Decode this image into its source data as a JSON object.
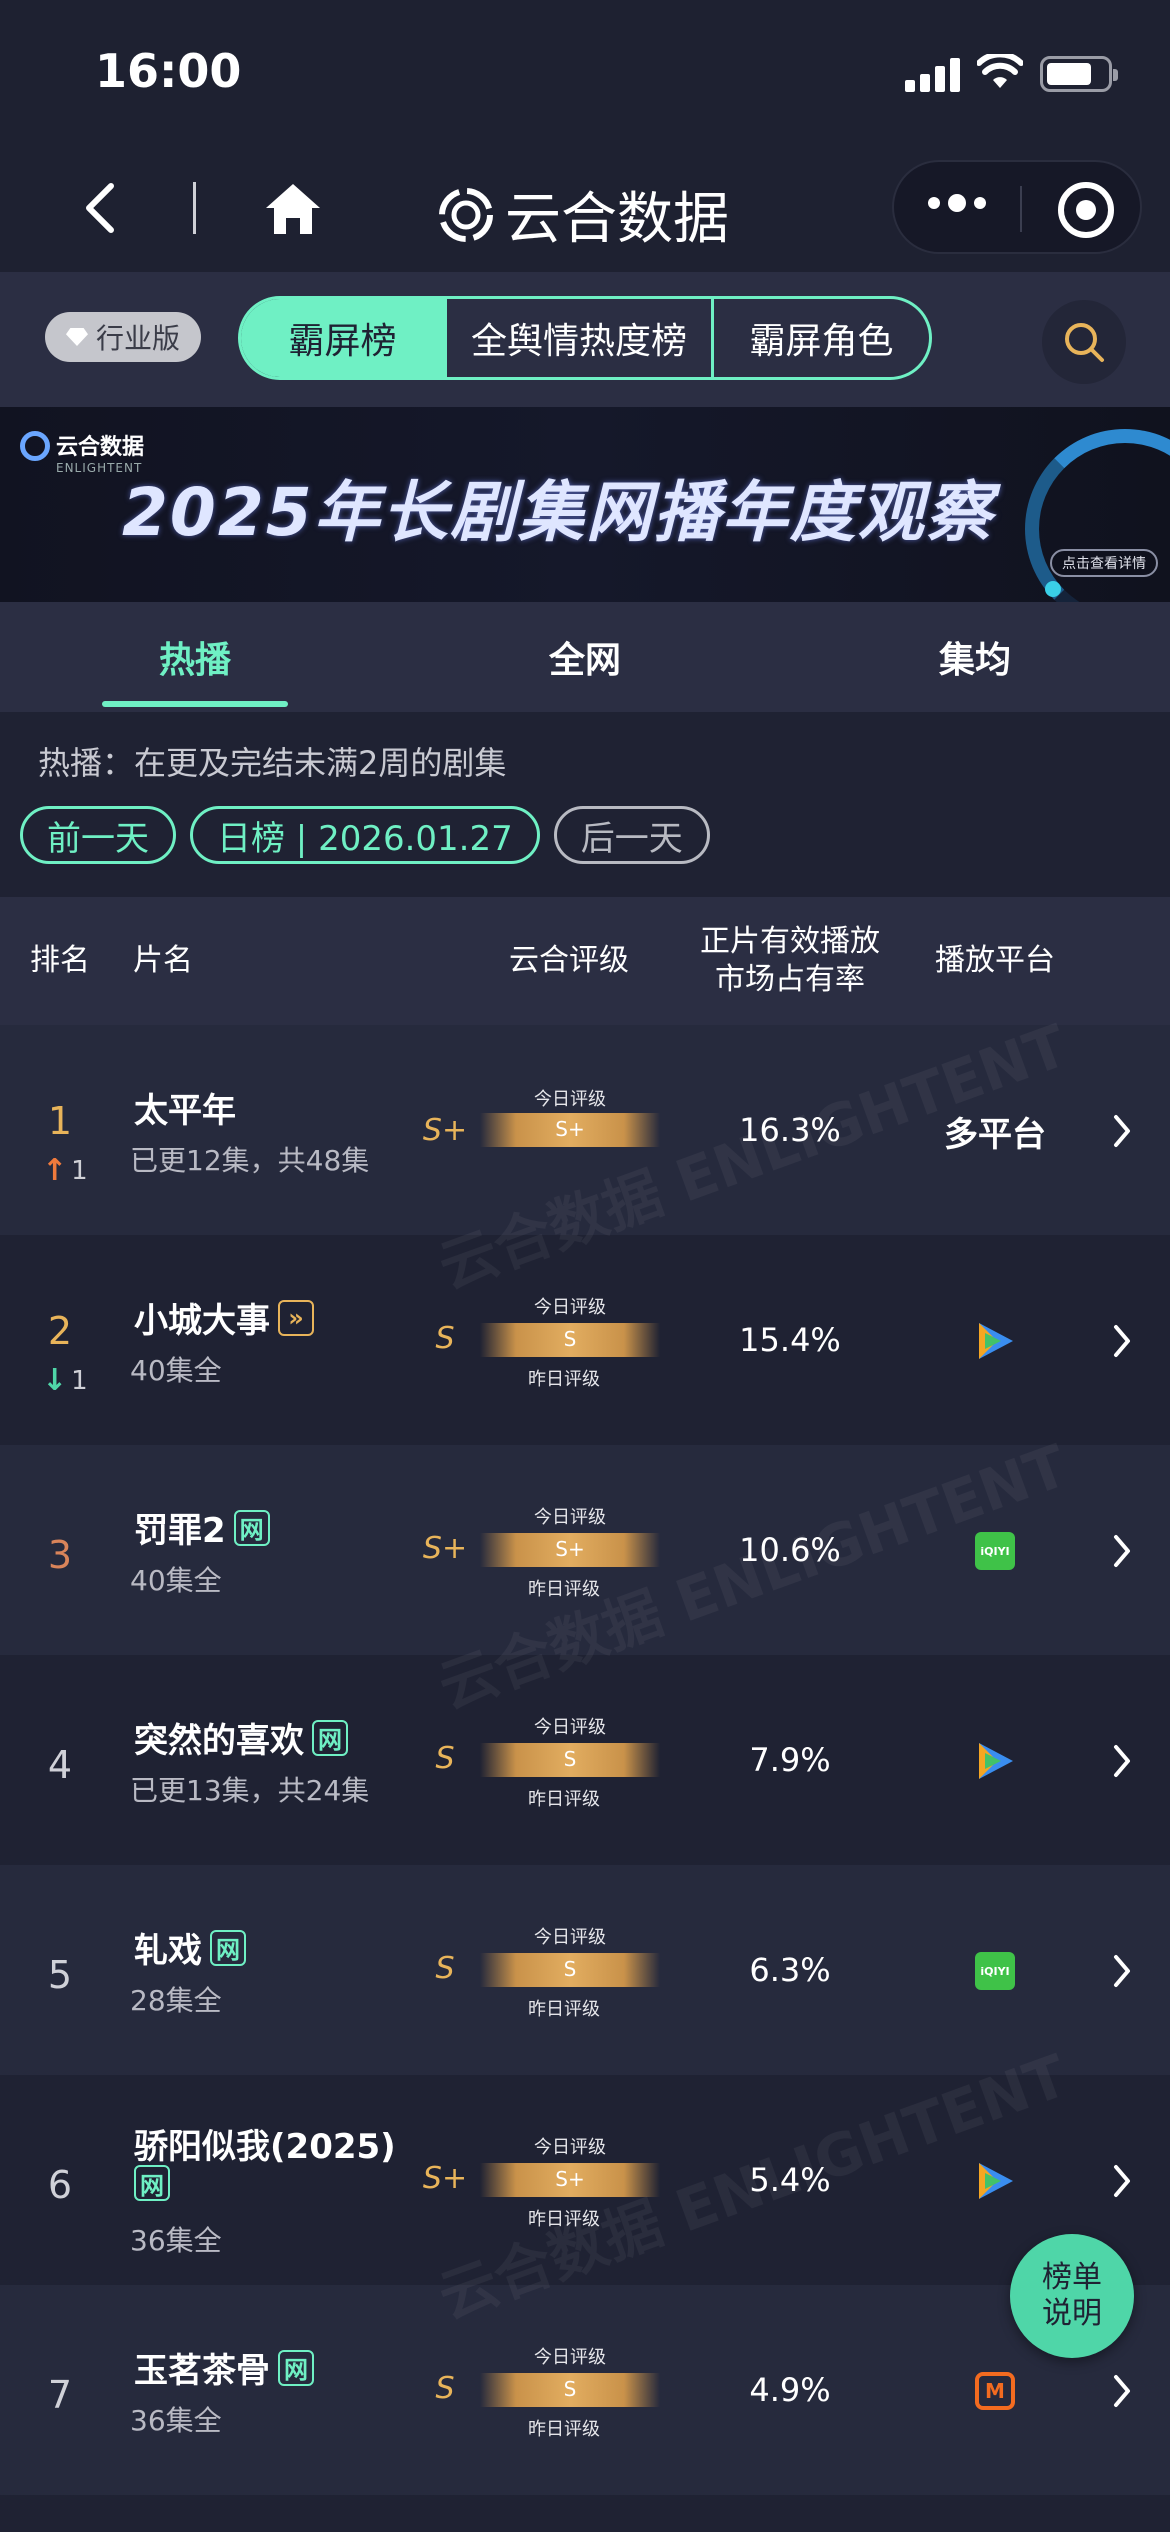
{
  "status": {
    "time": "16:00"
  },
  "nav": {
    "brand": "云合数据"
  },
  "toolbar": {
    "edition": "行业版",
    "tabs": [
      "霸屏榜",
      "全舆情热度榜",
      "霸屏角色"
    ],
    "active_tab": "霸屏榜"
  },
  "banner": {
    "logo_name": "云合数据",
    "logo_sub": "ENLIGHTENT",
    "title": "2025年长剧集网播年度观察",
    "cta": "点击查看详情"
  },
  "main_tabs": [
    "热播",
    "全网",
    "集均"
  ],
  "active_main_tab": "热播",
  "note": "热播：在更及完结未满2周的剧集",
  "date_nav": {
    "prev": "前一天",
    "current": "日榜 | 2026.01.27",
    "next": "后一天"
  },
  "table": {
    "headers": {
      "rank": "排名",
      "title": "片名",
      "rating": "云合评级",
      "share_l1": "正片有效播放",
      "share_l2": "市场占有率",
      "platform": "播放平台"
    },
    "grade_today_caption": "今日评级",
    "grade_yesterday_caption": "昨日评级",
    "rows": [
      {
        "rank": "1",
        "trend_dir": "up",
        "trend": "1",
        "title": "太平年",
        "tag": "",
        "subtitle": "已更12集，共48集",
        "grade": "S+",
        "bar_grade": "S+",
        "show_yesterday": false,
        "share": "16.3%",
        "platform": "多平台",
        "platform_icon": "text"
      },
      {
        "rank": "2",
        "trend_dir": "down",
        "trend": "1",
        "title": "小城大事",
        "tag": "»",
        "tag_style": "gold",
        "subtitle": "40集全",
        "grade": "S",
        "bar_grade": "S",
        "show_yesterday": true,
        "share": "15.4%",
        "platform": "",
        "platform_icon": "tencent-video-icon"
      },
      {
        "rank": "3",
        "trend_dir": "",
        "trend": "",
        "title": "罚罪2",
        "tag": "网",
        "subtitle": "40集全",
        "grade": "S+",
        "bar_grade": "S+",
        "show_yesterday": true,
        "share": "10.6%",
        "platform": "iQIYI",
        "platform_icon": "iqiyi-icon"
      },
      {
        "rank": "4",
        "trend_dir": "",
        "trend": "",
        "title": "突然的喜欢",
        "tag": "网",
        "subtitle": "已更13集，共24集",
        "grade": "S",
        "bar_grade": "S",
        "show_yesterday": true,
        "share": "7.9%",
        "platform": "",
        "platform_icon": "tencent-video-icon"
      },
      {
        "rank": "5",
        "trend_dir": "",
        "trend": "",
        "title": "轧戏",
        "tag": "网",
        "subtitle": "28集全",
        "grade": "S",
        "bar_grade": "S",
        "show_yesterday": true,
        "share": "6.3%",
        "platform": "iQIYI",
        "platform_icon": "iqiyi-icon"
      },
      {
        "rank": "6",
        "trend_dir": "",
        "trend": "",
        "title": "骄阳似我(2025)",
        "tag": "网",
        "subtitle": "36集全",
        "grade": "S+",
        "bar_grade": "S+",
        "show_yesterday": true,
        "share": "5.4%",
        "platform": "",
        "platform_icon": "tencent-video-icon"
      },
      {
        "rank": "7",
        "trend_dir": "",
        "trend": "",
        "title": "玉茗茶骨",
        "tag": "网",
        "subtitle": "36集全",
        "grade": "S",
        "bar_grade": "S",
        "show_yesterday": true,
        "share": "4.9%",
        "platform": "",
        "platform_icon": "mango-tv-icon"
      }
    ]
  },
  "float_button": {
    "line1": "榜单",
    "line2": "说明"
  },
  "watermark": "云合数据 ENLIGHTENT",
  "colors": {
    "accent": "#6ff0c4",
    "gold": "#e8b45a",
    "up": "#f07a3c",
    "down": "#4fd6a8",
    "bg": "#1f2233"
  }
}
